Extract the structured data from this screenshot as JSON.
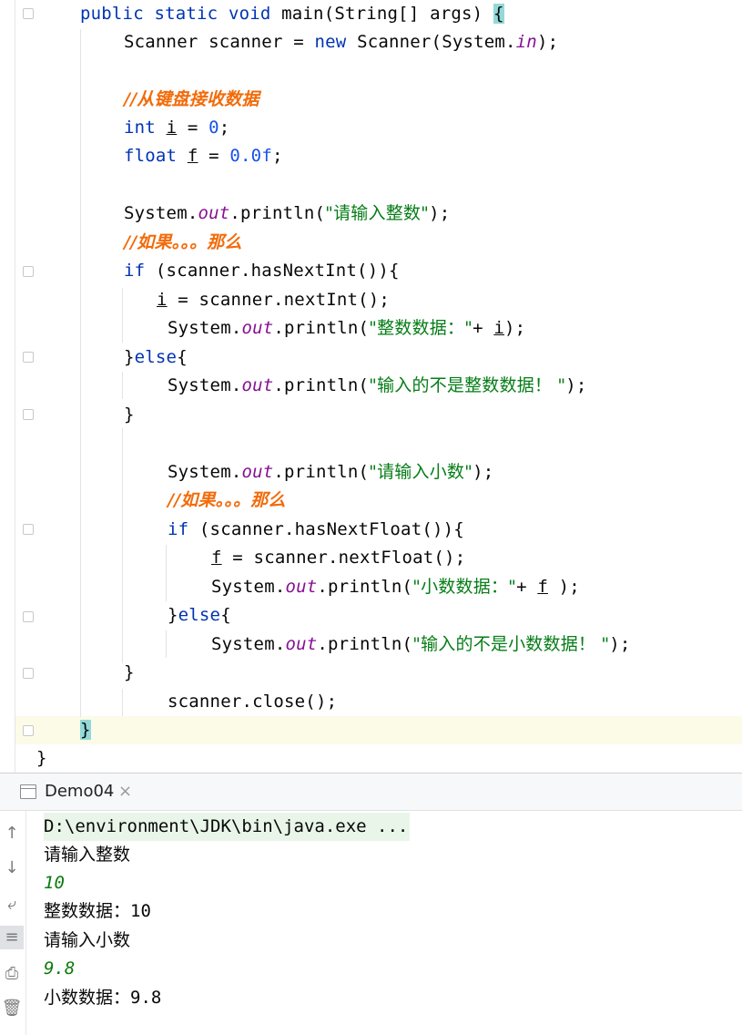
{
  "editor": {
    "lines": [
      [
        [
          "kw",
          "public static void "
        ],
        [
          "fn",
          "main"
        ],
        [
          "p",
          "(String[] args) "
        ],
        [
          "bh",
          "{"
        ]
      ],
      [
        [
          "p",
          "Scanner scanner = "
        ],
        [
          "kw",
          "new "
        ],
        [
          "p",
          "Scanner(System."
        ],
        [
          "field",
          "in"
        ],
        [
          "p",
          ");"
        ]
      ],
      [],
      [
        [
          "comment",
          "//从键盘接收数据"
        ]
      ],
      [
        [
          "kw",
          "int "
        ],
        [
          "u",
          "i"
        ],
        [
          "p",
          " = "
        ],
        [
          "num",
          "0"
        ],
        [
          "p",
          ";"
        ]
      ],
      [
        [
          "kw",
          "float "
        ],
        [
          "u",
          "f"
        ],
        [
          "p",
          " = "
        ],
        [
          "num",
          "0.0f"
        ],
        [
          "p",
          ";"
        ]
      ],
      [],
      [
        [
          "p",
          "System."
        ],
        [
          "field",
          "out"
        ],
        [
          "p",
          ".println("
        ],
        [
          "str",
          "\"请输入整数\""
        ],
        [
          "p",
          ");"
        ]
      ],
      [
        [
          "comment",
          "//如果。。。那么"
        ]
      ],
      [
        [
          "kw",
          "if "
        ],
        [
          "p",
          "(scanner.hasNextInt()){"
        ]
      ],
      [
        [
          "u",
          "i"
        ],
        [
          "p",
          " = scanner.nextInt();"
        ]
      ],
      [
        [
          "p",
          "System."
        ],
        [
          "field",
          "out"
        ],
        [
          "p",
          ".println("
        ],
        [
          "str",
          "\"整数数据：\""
        ],
        [
          "p",
          "+ "
        ],
        [
          "u",
          "i"
        ],
        [
          "p",
          ");"
        ]
      ],
      [
        [
          "p",
          "}"
        ],
        [
          "kw",
          "else"
        ],
        [
          "p",
          "{"
        ]
      ],
      [
        [
          "p",
          "System."
        ],
        [
          "field",
          "out"
        ],
        [
          "p",
          ".println("
        ],
        [
          "str",
          "\"输入的不是整数数据！ \""
        ],
        [
          "p",
          ");"
        ]
      ],
      [
        [
          "p",
          "}"
        ]
      ],
      [],
      [
        [
          "p",
          "System."
        ],
        [
          "field",
          "out"
        ],
        [
          "p",
          ".println("
        ],
        [
          "str",
          "\"请输入小数\""
        ],
        [
          "p",
          ");"
        ]
      ],
      [
        [
          "comment",
          "//如果。。。那么"
        ]
      ],
      [
        [
          "kw",
          "if "
        ],
        [
          "p",
          "(scanner.hasNextFloat()){"
        ]
      ],
      [
        [
          "u",
          "f"
        ],
        [
          "p",
          " = scanner.nextFloat();"
        ]
      ],
      [
        [
          "p",
          "System."
        ],
        [
          "field",
          "out"
        ],
        [
          "p",
          ".println("
        ],
        [
          "str",
          "\"小数数据：\""
        ],
        [
          "p",
          "+ "
        ],
        [
          "u",
          "f"
        ],
        [
          "p",
          " );"
        ]
      ],
      [
        [
          "p",
          "}"
        ],
        [
          "kw",
          "else"
        ],
        [
          "p",
          "{"
        ]
      ],
      [
        [
          "p",
          "System."
        ],
        [
          "field",
          "out"
        ],
        [
          "p",
          ".println("
        ],
        [
          "str",
          "\"输入的不是小数数据！ \""
        ],
        [
          "p",
          ");"
        ]
      ],
      [
        [
          "p",
          "}"
        ]
      ],
      [
        [
          "p",
          "scanner.close();"
        ]
      ],
      [
        [
          "bh",
          "}"
        ]
      ],
      [
        [
          "p",
          "}"
        ]
      ]
    ]
  },
  "run_panel": {
    "tab_label": "Demo04",
    "tab_close": "×",
    "tools": [
      {
        "icon": "arrow-up-icon",
        "glyph": "↑"
      },
      {
        "icon": "arrow-down-icon",
        "glyph": "↓"
      },
      {
        "icon": "soft-wrap-icon",
        "glyph": "⤶"
      },
      {
        "icon": "scroll-to-end-icon",
        "glyph": "≡"
      },
      {
        "icon": "print-icon",
        "glyph": "⎙"
      },
      {
        "icon": "trash-icon",
        "glyph": "🗑"
      }
    ],
    "console": [
      {
        "text": "D:\\environment\\JDK\\bin\\java.exe ...",
        "kind": "cmd"
      },
      {
        "text": "请输入整数",
        "kind": "out"
      },
      {
        "text": "10",
        "kind": "input"
      },
      {
        "text": "整数数据：10",
        "kind": "out"
      },
      {
        "text": "请输入小数",
        "kind": "out"
      },
      {
        "text": "9.8",
        "kind": "input"
      },
      {
        "text": "小数数据：9.8",
        "kind": "out"
      }
    ]
  }
}
